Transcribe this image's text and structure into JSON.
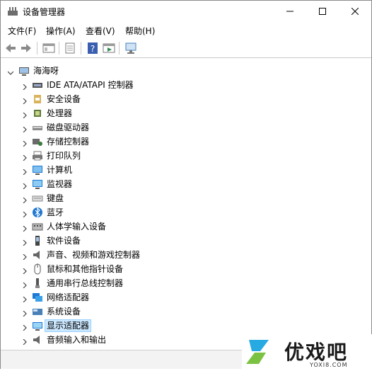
{
  "title": "设备管理器",
  "window_buttons": {
    "minimize": "—",
    "maximize": "☐",
    "close": "✕"
  },
  "menu": [
    "文件(F)",
    "操作(A)",
    "查看(V)",
    "帮助(H)"
  ],
  "tree": {
    "root_label": "海海呀",
    "items": [
      {
        "label": "IDE ATA/ATAPI 控制器",
        "icon": "ide-controller-icon"
      },
      {
        "label": "安全设备",
        "icon": "security-device-icon"
      },
      {
        "label": "处理器",
        "icon": "processor-icon"
      },
      {
        "label": "磁盘驱动器",
        "icon": "disk-drive-icon"
      },
      {
        "label": "存储控制器",
        "icon": "storage-controller-icon"
      },
      {
        "label": "打印队列",
        "icon": "printer-icon"
      },
      {
        "label": "计算机",
        "icon": "computer-icon"
      },
      {
        "label": "监视器",
        "icon": "monitor-icon"
      },
      {
        "label": "键盘",
        "icon": "keyboard-icon"
      },
      {
        "label": "蓝牙",
        "icon": "bluetooth-icon"
      },
      {
        "label": "人体学输入设备",
        "icon": "hid-icon"
      },
      {
        "label": "软件设备",
        "icon": "software-device-icon"
      },
      {
        "label": "声音、视频和游戏控制器",
        "icon": "audio-icon"
      },
      {
        "label": "鼠标和其他指针设备",
        "icon": "mouse-icon"
      },
      {
        "label": "通用串行总线控制器",
        "icon": "usb-icon"
      },
      {
        "label": "网络适配器",
        "icon": "network-adapter-icon"
      },
      {
        "label": "系统设备",
        "icon": "system-device-icon"
      },
      {
        "label": "显示适配器",
        "icon": "display-adapter-icon",
        "selected": true
      },
      {
        "label": "音频输入和输出",
        "icon": "audio-io-icon"
      }
    ]
  },
  "watermark": {
    "brand": "优戏吧",
    "url": "YOXI8.COM"
  },
  "colors": {
    "selected_bg": "#cce8ff",
    "accent_blue": "#1e78d2"
  }
}
